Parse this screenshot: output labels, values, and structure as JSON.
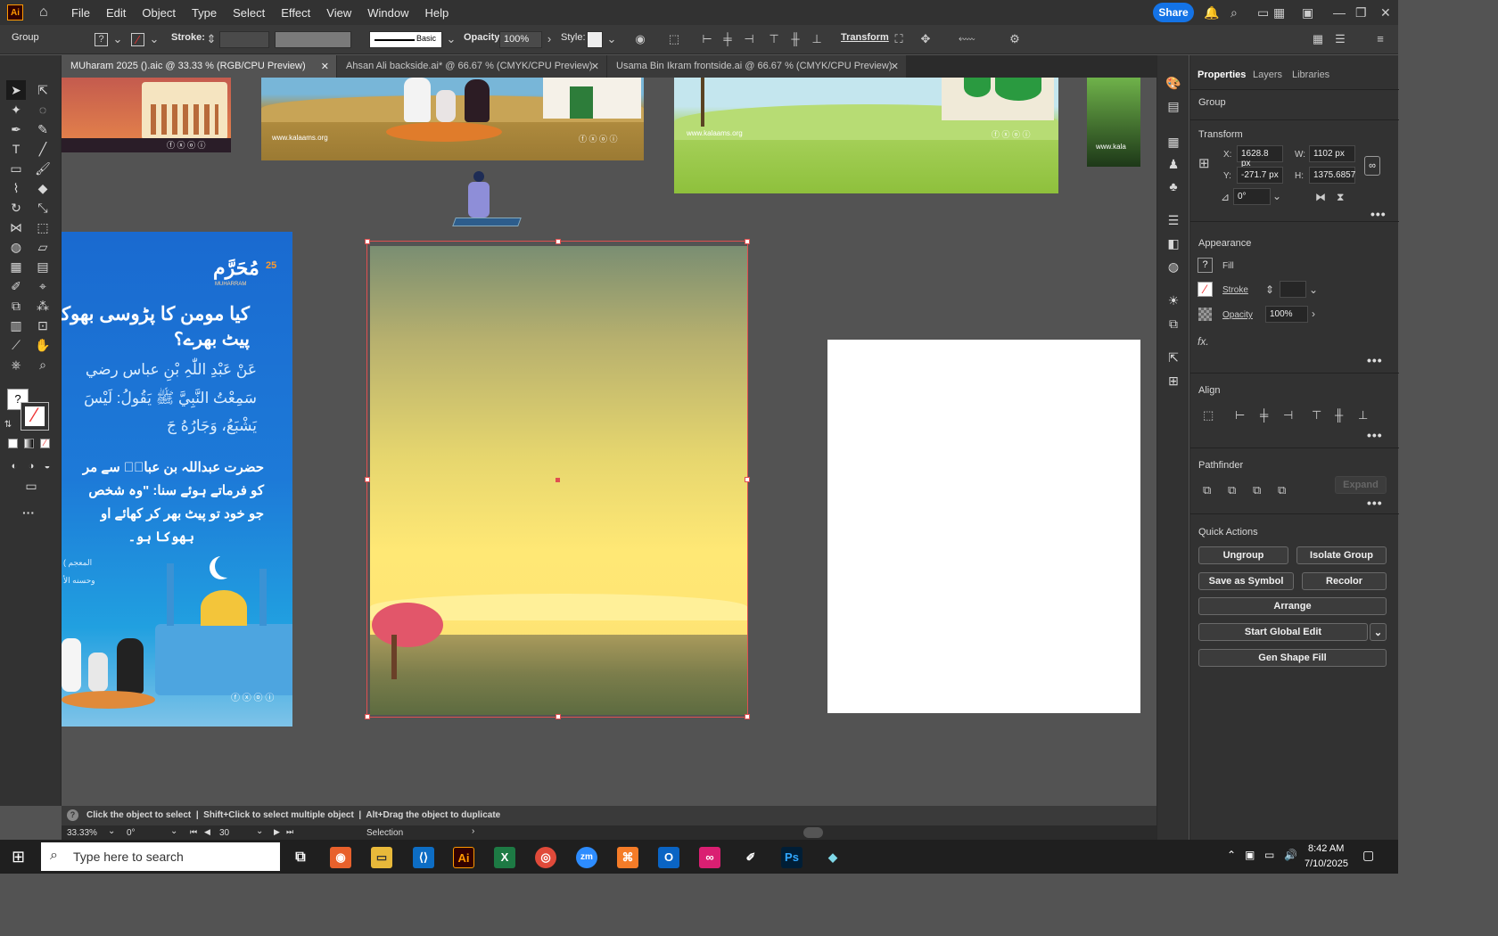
{
  "menubar": {
    "logo": "Ai",
    "items": [
      "File",
      "Edit",
      "Object",
      "Type",
      "Select",
      "Effect",
      "View",
      "Window",
      "Help"
    ],
    "share_label": "Share"
  },
  "controlbar": {
    "selection_type": "Group",
    "stroke_label": "Stroke:",
    "brush_label": "Basic",
    "opacity_label": "Opacity:",
    "opacity_value": "100%",
    "style_label": "Style:",
    "transform_label": "Transform"
  },
  "tabs": [
    {
      "label": "MUharam 2025 ().aic @ 33.33 % (RGB/CPU Preview)",
      "active": true
    },
    {
      "label": "Ahsan Ali backside.ai* @ 66.67 % (CMYK/CPU Preview)",
      "active": false
    },
    {
      "label": "Usama Bin Ikram frontside.ai @ 66.67 % (CMYK/CPU Preview)",
      "active": false
    }
  ],
  "canvas": {
    "website": "www.kalaams.org",
    "urdu_heading_1": "کیا مومن کا پڑوسی بھوکا",
    "urdu_heading_2": "پیٹ بھرے؟",
    "arabic_1": "عَنْ عَبْدِ اللّٰہِ بْنِ عباس رضي",
    "arabic_2": "سَمِعْتُ النَّبِيَّ ﷺ يَقُولُ: لَيْسَ",
    "arabic_3": "يَشْبَعُ، وَجَارُهُ جَ",
    "urdu_1": "حضرت عبداللہ بن عباسؓ سے مر",
    "urdu_2": "کو فرماتے ہوئے سنا: \"وہ شخص",
    "urdu_3": "جو خود تو پیٹ بھر کر کھائے او",
    "urdu_4": "بھوکا ہو۔",
    "source_1": "( المعجم",
    "source_2": "وحسنه الأ",
    "muharram_logo": "مُحَرَّم",
    "muharram_num": "25",
    "muharram_latin": "MUHARRAM"
  },
  "properties": {
    "tabs": [
      "Properties",
      "Layers",
      "Libraries"
    ],
    "selection": "Group",
    "transform_title": "Transform",
    "x_label": "X:",
    "x_value": "1628.8 px",
    "y_label": "Y:",
    "y_value": "-271.7 px",
    "w_label": "W:",
    "w_value": "1102 px",
    "h_label": "H:",
    "h_value": "1375.6857",
    "angle_value": "0°",
    "appearance_title": "Appearance",
    "fill_label": "Fill",
    "stroke_label": "Stroke",
    "opacity_label": "Opacity",
    "opacity_value": "100%",
    "fx_label": "fx.",
    "align_title": "Align",
    "pathfinder_title": "Pathfinder",
    "expand_label": "Expand",
    "quick_actions_title": "Quick Actions",
    "ungroup": "Ungroup",
    "isolate_group": "Isolate Group",
    "save_as_symbol": "Save as Symbol",
    "recolor": "Recolor",
    "arrange": "Arrange",
    "start_global_edit": "Start Global Edit",
    "gen_shape_fill": "Gen Shape Fill"
  },
  "statusbar": {
    "hint": "Click the object to select  |  Shift+Click to select multiple object  |  Alt+Drag the object to duplicate",
    "zoom": "33.33%",
    "rotation": "0°",
    "artboard_num": "30",
    "tool": "Selection"
  },
  "taskbar": {
    "search_placeholder": "Type here to search",
    "time": "8:42 AM",
    "date": "7/10/2025"
  },
  "colors": {
    "accent": "#1473e6",
    "selection": "#e05050"
  }
}
